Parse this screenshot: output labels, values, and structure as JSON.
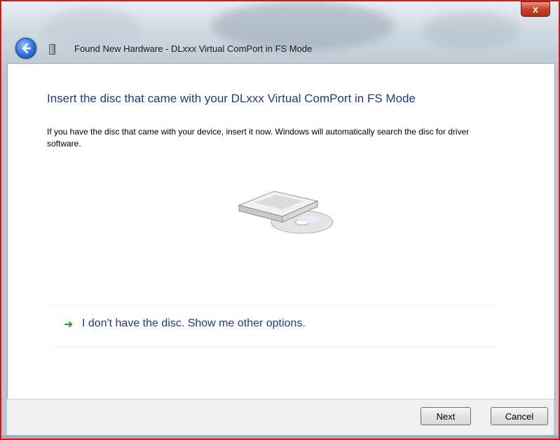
{
  "window": {
    "title": "Found New Hardware - DLxxx Virtual ComPort in FS Mode",
    "close_label": "x"
  },
  "content": {
    "heading": "Insert the disc that came with your DLxxx Virtual ComPort in FS Mode",
    "description": "If you have the disc that came with your device, insert it now.  Windows will automatically search the disc for driver software.",
    "option_text": "I don't have the disc.  Show me other options."
  },
  "footer": {
    "next_label": "Next",
    "cancel_label": "Cancel"
  },
  "colors": {
    "frame_border": "#d01a1a",
    "heading": "#1e3a8c",
    "arrow": "#1e9a2a"
  }
}
